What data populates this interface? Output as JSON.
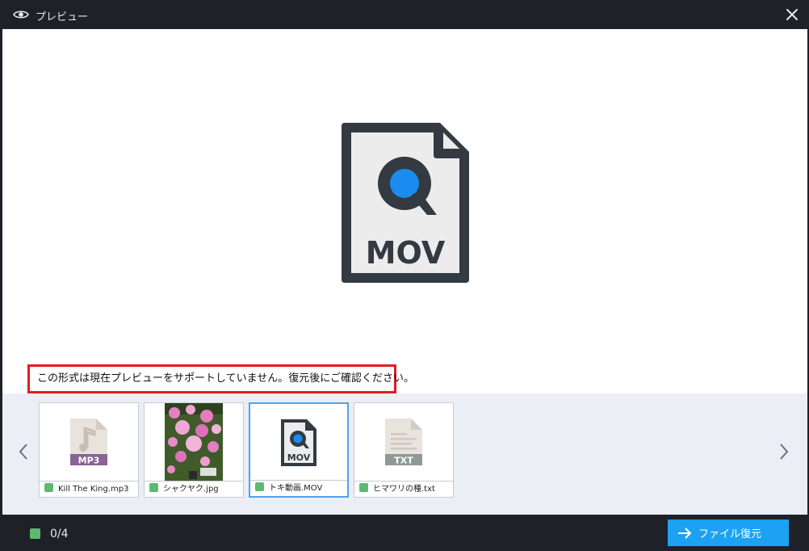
{
  "window": {
    "title": "プレビュー"
  },
  "preview": {
    "file_type_label": "MOV",
    "notice": "この形式は現在プレビューをサポートしていません。復元後にご確認ください。"
  },
  "thumbnails": [
    {
      "name": "Kill The King.mp3",
      "type_label": "MP3",
      "selected": false
    },
    {
      "name": "シャクヤク.jpg",
      "type_label": "",
      "selected": false
    },
    {
      "name": "トキ動画.MOV",
      "type_label": "MOV",
      "selected": true
    },
    {
      "name": "ヒマワリの種.txt",
      "type_label": "TXT",
      "selected": false
    }
  ],
  "footer": {
    "count": "0/4",
    "recover_label": "ファイル復元"
  },
  "colors": {
    "background_dark": "#1e2127",
    "accent": "#1da1f2",
    "check_green": "#5fb870",
    "notice_border": "#e21c24",
    "selected_border": "#4da3ee"
  }
}
